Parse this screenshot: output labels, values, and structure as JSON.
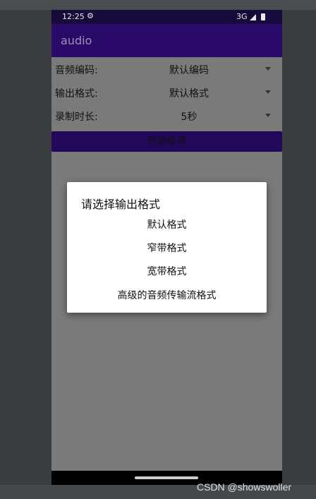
{
  "status_bar": {
    "time": "12:25",
    "gear_glyph": "⚙",
    "network": "3G"
  },
  "app_bar": {
    "title": "audio"
  },
  "form": {
    "rows": [
      {
        "label": "音频编码:",
        "value": "默认编码"
      },
      {
        "label": "输出格式:",
        "value": "默认格式"
      },
      {
        "label": "录制时长:",
        "value": "5秒"
      }
    ],
    "record_button": "开始录音"
  },
  "dialog": {
    "title": "请选择输出格式",
    "options": [
      "默认格式",
      "窄带格式",
      "宽带格式",
      "高级的音频传输流格式"
    ]
  },
  "watermark": "CSDN @showswoller",
  "colors": {
    "status_bar": "#160a3a",
    "app_bar": "#2a0a68",
    "button": "#22075a",
    "scrim": "#7a7a7a"
  }
}
